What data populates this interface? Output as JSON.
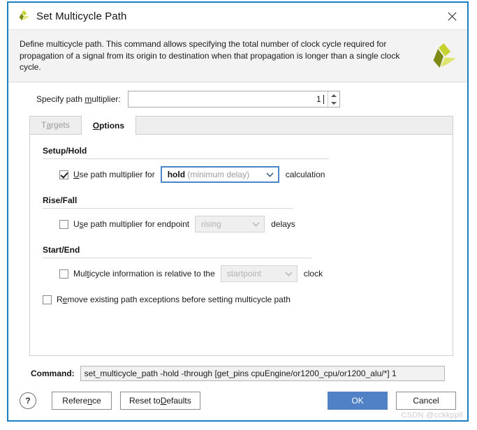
{
  "window": {
    "title": "Set Multicycle Path",
    "app_logo_icon": "xilinx-logo-icon",
    "close_icon": "close-icon",
    "accent_color": "#1b7fc4"
  },
  "banner": {
    "description": "Define multicycle path. This command allows specifying the total number of clock cycle required for propagation of a signal from its origin to destination when that propagation is longer than a single clock cycle.",
    "logo_icon": "xilinx-logo-icon"
  },
  "multiplier": {
    "label_pre": "Specify path ",
    "label_mnemonic": "m",
    "label_post": "ultiplier:",
    "value": "1",
    "spin_up_icon": "spinner-up-icon",
    "spin_down_icon": "spinner-down-icon"
  },
  "tabs": [
    {
      "id": "targets",
      "label_pre": "T",
      "label_mnemonic": "a",
      "label_post": "rgets",
      "state": "disabled"
    },
    {
      "id": "options",
      "label_pre": "",
      "label_mnemonic": "O",
      "label_post": "ptions",
      "state": "active"
    }
  ],
  "sections": [
    {
      "id": "setup-hold",
      "title": "Setup/Hold",
      "checkbox": {
        "checked": true,
        "text_pre": "",
        "mnemonic": "U",
        "text_post": "se path multiplier for"
      },
      "combo": {
        "state": "focused",
        "value_strong": "hold",
        "value_dim": "(minimum delay)",
        "chevron_icon": "chevron-down-icon"
      },
      "trailing_text": "calculation"
    },
    {
      "id": "rise-fall",
      "title": "Rise/Fall",
      "checkbox": {
        "checked": false,
        "text_pre": "U",
        "mnemonic": "s",
        "text_post": "e path multiplier for endpoint"
      },
      "combo": {
        "state": "disabled",
        "value_strong": "rising",
        "value_dim": "",
        "chevron_icon": "chevron-down-icon"
      },
      "trailing_text": "delays"
    },
    {
      "id": "start-end",
      "title": "Start/End",
      "checkbox": {
        "checked": false,
        "text_pre": "Mul",
        "mnemonic": "t",
        "text_post": "icycle information is relative to the"
      },
      "combo": {
        "state": "disabled",
        "value_strong": "startpoint",
        "value_dim": "",
        "chevron_icon": "chevron-down-icon"
      },
      "trailing_text": "clock"
    }
  ],
  "remove_option": {
    "checked": false,
    "text_pre": "R",
    "mnemonic": "e",
    "text_post": "move existing path exceptions before setting multicycle path"
  },
  "command": {
    "label": "Command:",
    "value": "set_multicycle_path -hold -through [get_pins cpuEngine/or1200_cpu/or1200_alu/*] 1"
  },
  "footer": {
    "help_label": "?",
    "reference": {
      "pre": "Refere",
      "mnemonic": "n",
      "post": "ce"
    },
    "reset": {
      "pre": "Reset to ",
      "mnemonic": "D",
      "post": "efaults"
    },
    "ok_label": "OK",
    "cancel_label": "Cancel",
    "ok_color": "#4f81c4"
  },
  "watermark": "CSDN @cckkppll"
}
